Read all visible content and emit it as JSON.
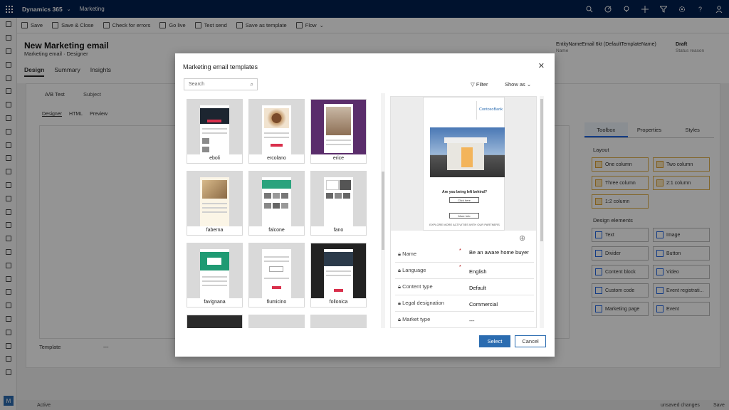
{
  "topbar": {
    "app_name": "Dynamics 365",
    "area": "Marketing",
    "icons": [
      "search-icon",
      "target-icon",
      "lightbulb-icon",
      "plus-icon",
      "filter-icon",
      "gear-icon",
      "help-icon",
      "user-icon"
    ]
  },
  "commandbar": {
    "items": [
      "Save",
      "Save & Close",
      "Check for errors",
      "Go live",
      "Test send",
      "Save as template",
      "Flow"
    ]
  },
  "header": {
    "title": "New Marketing email",
    "subtitle": "Marketing email · Designer",
    "name_value": "EntityNameEmail 6kt (DefaultTemplateName)",
    "name_label": "Name",
    "status_value": "Draft",
    "status_label": "Status reason",
    "tabs": [
      "Design",
      "Summary",
      "Insights"
    ]
  },
  "designer": {
    "ab_label": "A/B Test",
    "subject_label": "Subject",
    "modes": [
      "Designer",
      "HTML",
      "Preview"
    ],
    "template_label": "Template",
    "template_value": "---"
  },
  "rightpanel": {
    "tabs": [
      "Toolbox",
      "Properties",
      "Styles"
    ],
    "layout_label": "Layout",
    "layout_items": [
      "One column",
      "Two column",
      "Three column",
      "2:1 column",
      "1:2 column"
    ],
    "elements_label": "Design elements",
    "elements": [
      "Text",
      "Image",
      "Divider",
      "Button",
      "Content block",
      "Video",
      "Custom code",
      "Event registrati...",
      "Marketing page",
      "Event"
    ]
  },
  "statusbar": {
    "status": "Active",
    "unsaved": "unsaved changes",
    "save": "Save"
  },
  "dialog": {
    "title": "Marketing email templates",
    "search_placeholder": "Search",
    "filter_label": "Filter",
    "showas_label": "Show as",
    "templates": [
      "eboli",
      "ercolano",
      "erice",
      "faberna",
      "falcone",
      "fano",
      "favignana",
      "fiumicino",
      "follonica"
    ],
    "preview": {
      "logo": "ContosoBank",
      "heading": "Are you being left behind?",
      "button1": "Click here",
      "button2": "More Info",
      "footer": "EXPLORE MORE ACTIVITIES WITH OUR PARTNERS"
    },
    "fields": [
      {
        "label": "Name",
        "required": "*",
        "value": "Be an aware home buyer"
      },
      {
        "label": "Language",
        "required": "*",
        "value": "English"
      },
      {
        "label": "Content type",
        "required": "",
        "value": "Default"
      },
      {
        "label": "Legal designation",
        "required": "",
        "value": "Commercial"
      },
      {
        "label": "Market type",
        "required": "",
        "value": "---"
      }
    ],
    "select_label": "Select",
    "cancel_label": "Cancel"
  },
  "colors": {
    "topbar": "#002050",
    "accent": "#2b6cb0"
  }
}
